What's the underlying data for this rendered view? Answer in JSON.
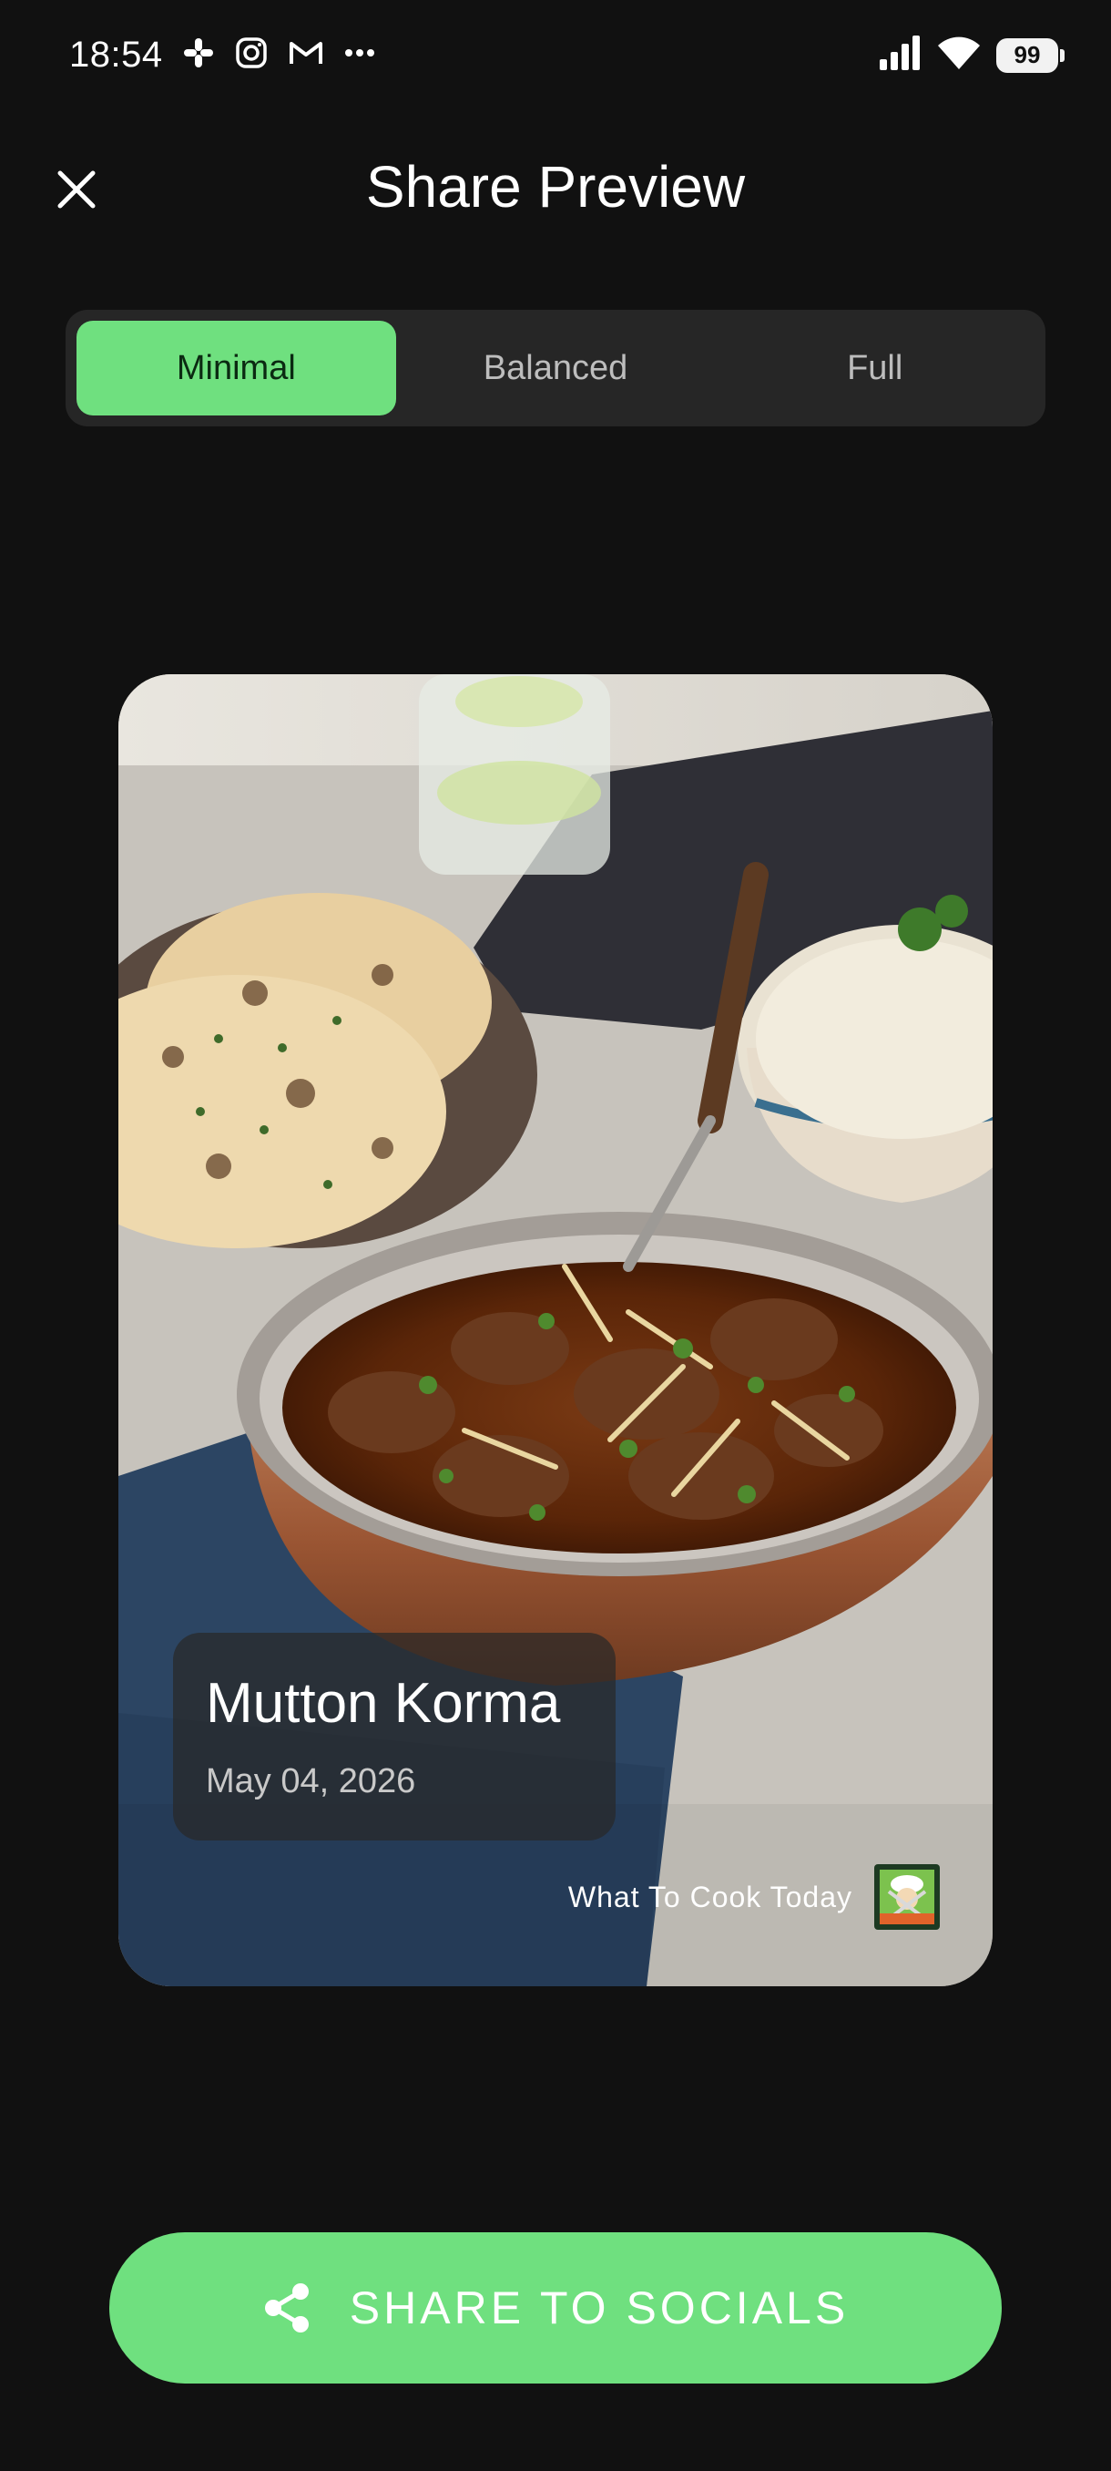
{
  "status_bar": {
    "time": "18:54",
    "battery": "99",
    "icons": [
      "slack-icon",
      "instagram-icon",
      "gmail-icon",
      "more-dots-icon",
      "signal-icon",
      "wifi-icon",
      "battery-icon"
    ]
  },
  "header": {
    "title": "Share Preview",
    "close_icon": "close-icon"
  },
  "layout_options": [
    {
      "label": "Minimal",
      "selected": true
    },
    {
      "label": "Balanced",
      "selected": false
    },
    {
      "label": "Full",
      "selected": false
    }
  ],
  "card": {
    "recipe_title": "Mutton Korma",
    "date": "May 04, 2026",
    "brand_name": "What To Cook Today",
    "brand_logo_icon": "chef-logo-icon"
  },
  "share_button": {
    "label": "SHARE TO SOCIALS",
    "icon": "share-icon"
  },
  "colors": {
    "accent": "#6fe07f",
    "background": "#111111",
    "segment_bg": "#262626"
  }
}
